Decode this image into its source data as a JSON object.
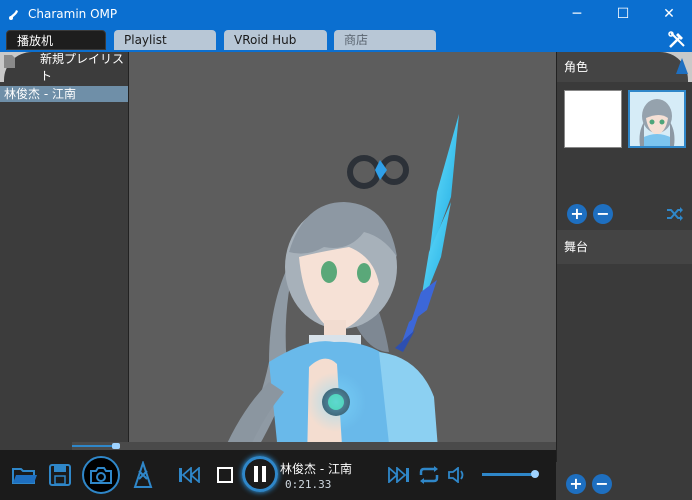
{
  "window": {
    "title": "Charamin OMP",
    "controls": {
      "minimize": "─",
      "maximize": "☐",
      "close": "✕"
    }
  },
  "tabs": [
    {
      "label": "播放机",
      "active": true
    },
    {
      "label": "Playlist",
      "active": false
    },
    {
      "label": "VRoid Hub",
      "active": false
    },
    {
      "label": "商店",
      "active": false
    }
  ],
  "playlist": {
    "header": "新規プレイリスト",
    "items": [
      "林俊杰 - 江南"
    ]
  },
  "right": {
    "characters_title": "角色",
    "stage_title": "舞台"
  },
  "player": {
    "now_playing": "林俊杰 - 江南",
    "time": "0:21.33",
    "progress": 0.09,
    "volume": 1.0
  },
  "icons": {
    "tools": "wrench-screwdriver-icon",
    "open": "folder-icon",
    "save": "save-icon",
    "camera": "camera-icon",
    "motion": "dancer-icon",
    "prev": "skip-back-icon",
    "stop": "stop-icon",
    "pause": "pause-icon",
    "next": "skip-forward-icon",
    "repeat": "repeat-icon",
    "volume": "speaker-icon",
    "shuffle": "shuffle-icon"
  },
  "colors": {
    "titlebar": "#0b6fd0",
    "accent": "#2f87c9",
    "highlight": "#6f8fa8"
  }
}
